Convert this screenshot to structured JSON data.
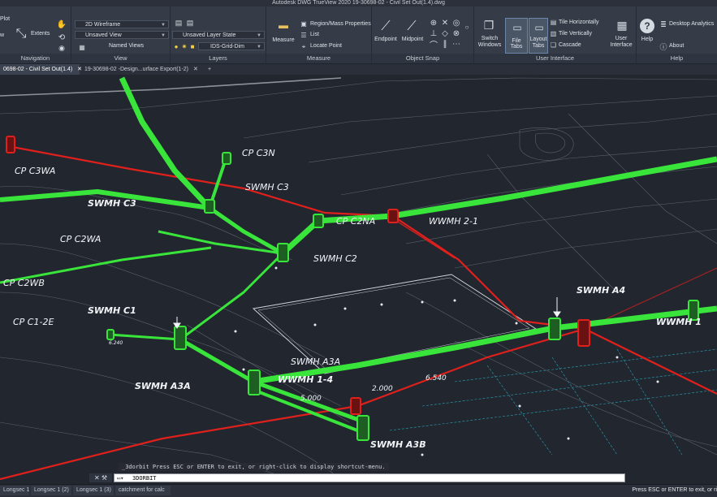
{
  "window": {
    "title": "Autodesk DWG TrueView 2020    19-30698-02 - Civil Set Out(1.4).dwg"
  },
  "ribbon": {
    "navigation": {
      "label": "Navigation",
      "plot": "Plot",
      "w": "w",
      "extents": "Extents"
    },
    "view": {
      "label": "View",
      "visual_style": "2D Wireframe",
      "named_view": "Unsaved View",
      "named_views": "Named Views"
    },
    "layers": {
      "label": "Layers",
      "layer_state": "Unsaved Layer State",
      "layer": "IDS-Grid-Dim"
    },
    "measure": {
      "label": "Measure",
      "measure": "Measure",
      "region": "Region/Mass Properties",
      "list": "List",
      "locate": "Locate Point"
    },
    "osnap": {
      "label": "Object Snap",
      "endpoint": "Endpoint",
      "midpoint": "Midpoint"
    },
    "ui": {
      "label": "User Interface",
      "switch_windows": "Switch\nWindows",
      "file_tabs": "File Tabs",
      "layout_tabs": "Layout\nTabs",
      "tile_h": "Tile Horizontally",
      "tile_v": "Tile Vertically",
      "cascade": "Cascade",
      "user_interface": "User\nInterface"
    },
    "help": {
      "label": "Help",
      "help": "Help",
      "desktop_analytics": "Desktop Analytics",
      "about": "About"
    }
  },
  "doc_tabs": [
    {
      "label": "0698-02 - Civil Set Out(1.4)",
      "close": "✕",
      "active": true
    },
    {
      "label": "19-30698-02 -Design...urface Export(1-2)",
      "close": "✕",
      "active": false
    },
    {
      "label": "+",
      "close": "",
      "active": false
    }
  ],
  "drawing_labels": {
    "cp_c3n": "CP C3N",
    "cp_c3wa": "CP C3WA",
    "swmh_c3_a": "SWMH C3",
    "swmh_c3_b": "SWMH C3",
    "cp_c2na": "CP C2NA",
    "wwmh_21": "WWMH 2-1",
    "cp_c2wa": "CP C2WA",
    "swmh_c2": "SWMH C2",
    "cp_c2wb": "CP C2WB",
    "swmh_c1": "SWMH C1",
    "cp_c12e": "CP C1-2E",
    "swmh_a4": "SWMH A4",
    "wwmh_1_edge": "WWMH 1",
    "swmh_a3a_top": "SWMH A3A",
    "wwmh_14": "WWMH 1-4",
    "swmh_a3a": "SWMH A3A",
    "swmh_a3b": "SWMH A3B",
    "dim_5000": "5.000",
    "dim_2000": "2.000",
    "dim_6540": "6.540",
    "dim_small": "6.240"
  },
  "command": {
    "history": "_3dorbit Press ESC or ENTER to exit, or right-click to display shortcut-menu.",
    "input": "3DORBIT",
    "close_icon": "✕"
  },
  "layout_tabs": [
    "Longsec 1",
    "Longsec 1 (2)",
    "Longsec 1 (3)",
    "catchment for calc"
  ],
  "status_text": "Press ESC or ENTER to exit, or ri",
  "colors": {
    "pipe_green": "#39e53a",
    "pipe_red": "#e0201c",
    "background": "#21262f",
    "ribbon": "#353b47"
  }
}
